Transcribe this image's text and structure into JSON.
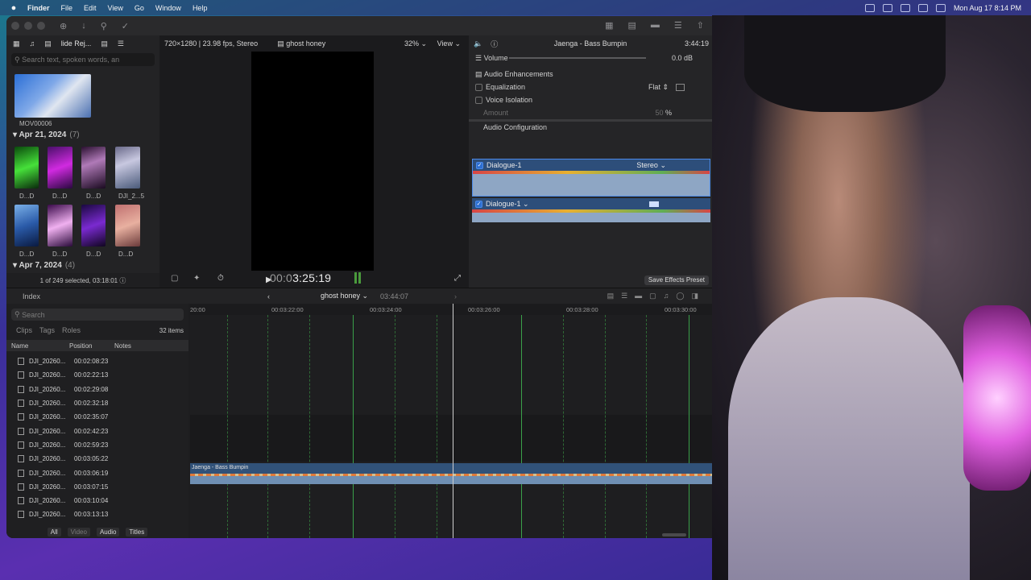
{
  "menubar": {
    "apple": "",
    "app": "Finder",
    "items": [
      "File",
      "Edit",
      "View",
      "Go",
      "Window",
      "Help"
    ],
    "clock": "Mon Aug 17  8:14 PM"
  },
  "browser": {
    "library": "lide Rej...",
    "search_placeholder": "Search text, spoken words, an",
    "first_clip": "MOV00006",
    "groups": [
      {
        "date": "Apr 21, 2024",
        "count": "(7)"
      },
      {
        "date": "Apr 7, 2024",
        "count": "(4)"
      }
    ],
    "clips_row1": [
      "D...D",
      "D...D",
      "D...D",
      "DJI_2...5"
    ],
    "clips_row2": [
      "D...D",
      "D...D",
      "D...D",
      "D...D"
    ],
    "status": "1 of 249 selected, 03:18:01"
  },
  "viewer": {
    "format": "720×1280 | 23.98 fps, Stereo",
    "project": "ghost honey",
    "zoom": "32%",
    "view": "View",
    "timecode_dim": "00:0",
    "timecode": "3:25:19"
  },
  "inspector": {
    "title": "Jaenga - Bass Bumpin",
    "duration": "3:44:19",
    "volume_label": "Volume",
    "volume_value": "0.0",
    "volume_unit": "dB",
    "enhancements": "Audio Enhancements",
    "equalization": "Equalization",
    "eq_value": "Flat",
    "voice_isolation": "Voice Isolation",
    "amount": "Amount",
    "amount_value": "50",
    "amount_unit": "%",
    "config": "Audio Configuration",
    "comp1": "Dialogue-1",
    "comp1_mode": "Stereo",
    "comp2": "Dialogue-1",
    "save_preset": "Save Effects Preset"
  },
  "timeline_bar": {
    "index": "Index",
    "project": "ghost honey",
    "duration": "03:44:07"
  },
  "index": {
    "search_placeholder": "Search",
    "tabs": [
      "Clips",
      "Tags",
      "Roles"
    ],
    "items": "32 items",
    "columns": [
      "Name",
      "Position",
      "Notes"
    ],
    "rows": [
      {
        "name": "DJI_20260...",
        "pos": "00:02:08:23"
      },
      {
        "name": "DJI_20260...",
        "pos": "00:02:22:13"
      },
      {
        "name": "DJI_20260...",
        "pos": "00:02:29:08"
      },
      {
        "name": "DJI_20260...",
        "pos": "00:02:32:18"
      },
      {
        "name": "DJI_20260...",
        "pos": "00:02:35:07"
      },
      {
        "name": "DJI_20260...",
        "pos": "00:02:42:23"
      },
      {
        "name": "DJI_20260...",
        "pos": "00:02:59:23"
      },
      {
        "name": "DJI_20260...",
        "pos": "00:03:05:22"
      },
      {
        "name": "DJI_20260...",
        "pos": "00:03:06:19"
      },
      {
        "name": "DJI_20260...",
        "pos": "00:03:07:15"
      },
      {
        "name": "DJI_20260...",
        "pos": "00:03:10:04"
      },
      {
        "name": "DJI_20260...",
        "pos": "00:03:13:13"
      }
    ],
    "bottom": [
      "All",
      "Video",
      "Audio",
      "Titles"
    ]
  },
  "timeline": {
    "ruler": [
      "20:00",
      "00:03:22:00",
      "00:03:24:00",
      "00:03:26:00",
      "00:03:28:00",
      "00:03:30:00"
    ],
    "clip_label": "Jaenga - Bass Bumpin"
  }
}
